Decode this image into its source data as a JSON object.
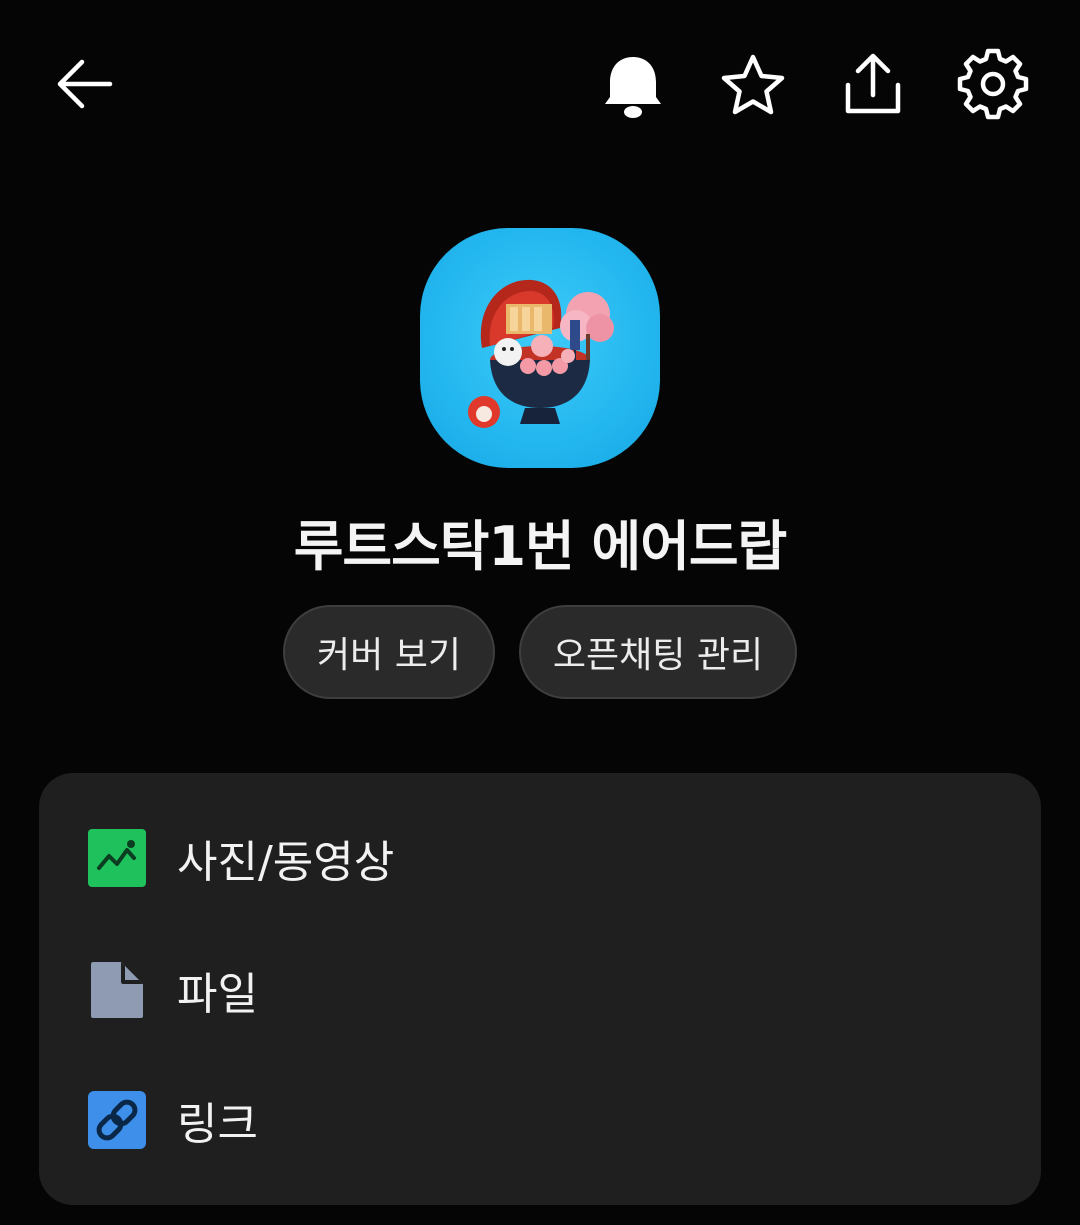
{
  "header": {
    "back_icon": "arrow-left-icon",
    "actions": [
      "bell-icon",
      "star-icon",
      "share-icon",
      "gear-icon"
    ]
  },
  "profile": {
    "name": "루트스탁1번 에어드랍",
    "image": "profile-image-blue-bowl-illustration"
  },
  "buttons": {
    "view_cover": "커버 보기",
    "manage_openchat": "오픈채팅 관리"
  },
  "menu": {
    "items": [
      {
        "label": "사진/동영상",
        "icon": "photo-icon",
        "color": "#1ec15b"
      },
      {
        "label": "파일",
        "icon": "file-icon",
        "color": "#8e9bb2"
      },
      {
        "label": "링크",
        "icon": "link-icon",
        "color": "#3d8fea"
      }
    ]
  },
  "colors": {
    "background": "#050505",
    "card": "#1f1f1f",
    "pill": "#2a2a2a",
    "profile_bg": "#23b7ef"
  }
}
